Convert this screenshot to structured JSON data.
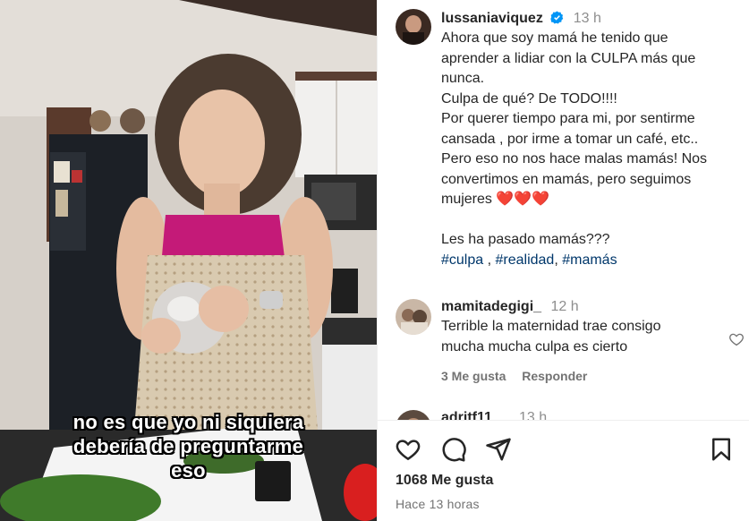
{
  "video": {
    "subtitle_lines": [
      "no es que yo ni siquiera",
      "debería de preguntarme",
      "eso"
    ]
  },
  "post": {
    "username": "lussaniaviquez",
    "time": "13 h",
    "caption_lines": [
      "Ahora que soy mamá he tenido que",
      "aprender a lidiar con la CULPA más que",
      "nunca.",
      "Culpa de qué? De TODO!!!!",
      "Por querer tiempo para mi, por sentirme",
      "cansada , por irme a tomar un café, etc..",
      "Pero eso no nos hace malas mamás! Nos",
      "convertimos en mamás, pero seguimos",
      "mujeres ❤️❤️❤️",
      "",
      "Les ha pasado mamás???"
    ],
    "hashtags": [
      "#culpa",
      "#realidad",
      "#mamás"
    ]
  },
  "comments": [
    {
      "username": "mamitadegigi_",
      "time": "12 h",
      "text_lines": [
        "Terrible la maternidad trae consigo",
        "mucha mucha culpa es cierto"
      ],
      "likes": "3 Me gusta",
      "reply": "Responder"
    }
  ],
  "comment_peek": {
    "username": "adritf11",
    "time": "13 h"
  },
  "footer": {
    "likes": "1068 Me gusta",
    "ago": "Hace 13 horas"
  },
  "icons": {
    "verified": "verified-badge-icon",
    "like": "heart-icon",
    "comment": "comment-bubble-icon",
    "share": "paper-plane-icon",
    "save": "bookmark-icon"
  },
  "colors": {
    "verified": "#0095f6",
    "hashtag": "#00376b",
    "muted": "#737373"
  }
}
